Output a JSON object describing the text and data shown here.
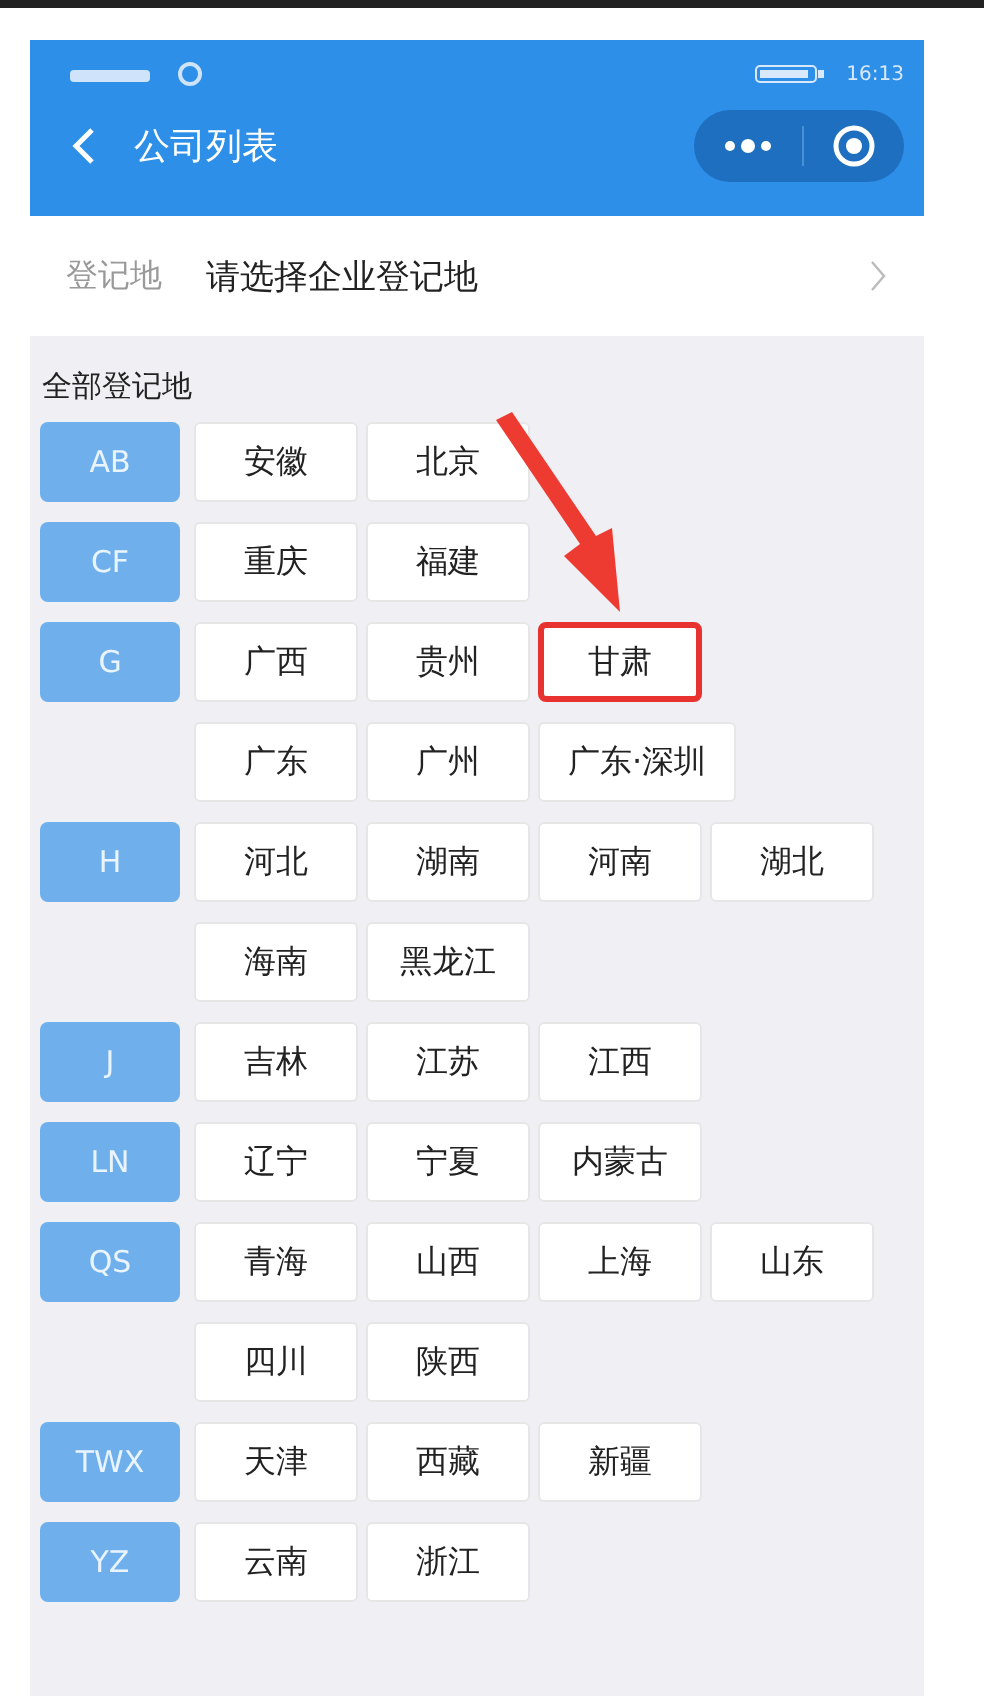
{
  "status_bar": {
    "time": "16:13"
  },
  "nav": {
    "title": "公司列表"
  },
  "picker": {
    "label": "登记地",
    "value": "请选择企业登记地"
  },
  "section_title": "全部登记地",
  "groups": [
    {
      "letter": "AB",
      "rows": [
        [
          {
            "name": "安徽",
            "highlighted": false
          },
          {
            "name": "北京",
            "highlighted": false
          }
        ]
      ]
    },
    {
      "letter": "CF",
      "rows": [
        [
          {
            "name": "重庆",
            "highlighted": false
          },
          {
            "name": "福建",
            "highlighted": false
          }
        ]
      ]
    },
    {
      "letter": "G",
      "rows": [
        [
          {
            "name": "广西",
            "highlighted": false
          },
          {
            "name": "贵州",
            "highlighted": false
          },
          {
            "name": "甘肃",
            "highlighted": true
          }
        ],
        [
          {
            "name": "广东",
            "highlighted": false
          },
          {
            "name": "广州",
            "highlighted": false
          },
          {
            "name": "广东·深圳",
            "highlighted": false
          }
        ]
      ]
    },
    {
      "letter": "H",
      "rows": [
        [
          {
            "name": "河北",
            "highlighted": false
          },
          {
            "name": "湖南",
            "highlighted": false
          },
          {
            "name": "河南",
            "highlighted": false
          },
          {
            "name": "湖北",
            "highlighted": false
          }
        ],
        [
          {
            "name": "海南",
            "highlighted": false
          },
          {
            "name": "黑龙江",
            "highlighted": false
          }
        ]
      ]
    },
    {
      "letter": "J",
      "rows": [
        [
          {
            "name": "吉林",
            "highlighted": false
          },
          {
            "name": "江苏",
            "highlighted": false
          },
          {
            "name": "江西",
            "highlighted": false
          }
        ]
      ]
    },
    {
      "letter": "LN",
      "rows": [
        [
          {
            "name": "辽宁",
            "highlighted": false
          },
          {
            "name": "宁夏",
            "highlighted": false
          },
          {
            "name": "内蒙古",
            "highlighted": false
          }
        ]
      ]
    },
    {
      "letter": "QS",
      "rows": [
        [
          {
            "name": "青海",
            "highlighted": false
          },
          {
            "name": "山西",
            "highlighted": false
          },
          {
            "name": "上海",
            "highlighted": false
          },
          {
            "name": "山东",
            "highlighted": false
          }
        ],
        [
          {
            "name": "四川",
            "highlighted": false
          },
          {
            "name": "陕西",
            "highlighted": false
          }
        ]
      ]
    },
    {
      "letter": "TWX",
      "rows": [
        [
          {
            "name": "天津",
            "highlighted": false
          },
          {
            "name": "西藏",
            "highlighted": false
          },
          {
            "name": "新疆",
            "highlighted": false
          }
        ]
      ]
    },
    {
      "letter": "YZ",
      "rows": [
        [
          {
            "name": "云南",
            "highlighted": false
          },
          {
            "name": "浙江",
            "highlighted": false
          }
        ]
      ]
    }
  ]
}
